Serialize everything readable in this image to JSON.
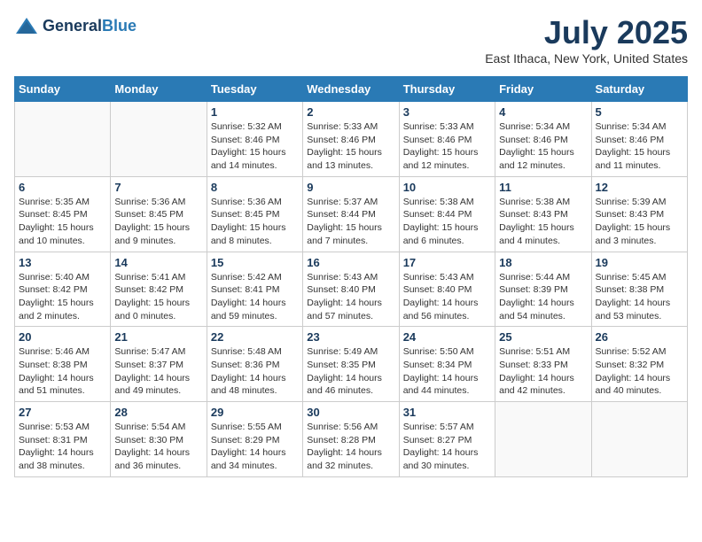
{
  "header": {
    "logo_line1": "General",
    "logo_line2": "Blue",
    "month": "July 2025",
    "location": "East Ithaca, New York, United States"
  },
  "days_of_week": [
    "Sunday",
    "Monday",
    "Tuesday",
    "Wednesday",
    "Thursday",
    "Friday",
    "Saturday"
  ],
  "weeks": [
    [
      {
        "day": "",
        "empty": true
      },
      {
        "day": "",
        "empty": true
      },
      {
        "day": "1",
        "sunrise": "5:32 AM",
        "sunset": "8:46 PM",
        "daylight": "15 hours and 14 minutes."
      },
      {
        "day": "2",
        "sunrise": "5:33 AM",
        "sunset": "8:46 PM",
        "daylight": "15 hours and 13 minutes."
      },
      {
        "day": "3",
        "sunrise": "5:33 AM",
        "sunset": "8:46 PM",
        "daylight": "15 hours and 12 minutes."
      },
      {
        "day": "4",
        "sunrise": "5:34 AM",
        "sunset": "8:46 PM",
        "daylight": "15 hours and 12 minutes."
      },
      {
        "day": "5",
        "sunrise": "5:34 AM",
        "sunset": "8:46 PM",
        "daylight": "15 hours and 11 minutes."
      }
    ],
    [
      {
        "day": "6",
        "sunrise": "5:35 AM",
        "sunset": "8:45 PM",
        "daylight": "15 hours and 10 minutes."
      },
      {
        "day": "7",
        "sunrise": "5:36 AM",
        "sunset": "8:45 PM",
        "daylight": "15 hours and 9 minutes."
      },
      {
        "day": "8",
        "sunrise": "5:36 AM",
        "sunset": "8:45 PM",
        "daylight": "15 hours and 8 minutes."
      },
      {
        "day": "9",
        "sunrise": "5:37 AM",
        "sunset": "8:44 PM",
        "daylight": "15 hours and 7 minutes."
      },
      {
        "day": "10",
        "sunrise": "5:38 AM",
        "sunset": "8:44 PM",
        "daylight": "15 hours and 6 minutes."
      },
      {
        "day": "11",
        "sunrise": "5:38 AM",
        "sunset": "8:43 PM",
        "daylight": "15 hours and 4 minutes."
      },
      {
        "day": "12",
        "sunrise": "5:39 AM",
        "sunset": "8:43 PM",
        "daylight": "15 hours and 3 minutes."
      }
    ],
    [
      {
        "day": "13",
        "sunrise": "5:40 AM",
        "sunset": "8:42 PM",
        "daylight": "15 hours and 2 minutes."
      },
      {
        "day": "14",
        "sunrise": "5:41 AM",
        "sunset": "8:42 PM",
        "daylight": "15 hours and 0 minutes."
      },
      {
        "day": "15",
        "sunrise": "5:42 AM",
        "sunset": "8:41 PM",
        "daylight": "14 hours and 59 minutes."
      },
      {
        "day": "16",
        "sunrise": "5:43 AM",
        "sunset": "8:40 PM",
        "daylight": "14 hours and 57 minutes."
      },
      {
        "day": "17",
        "sunrise": "5:43 AM",
        "sunset": "8:40 PM",
        "daylight": "14 hours and 56 minutes."
      },
      {
        "day": "18",
        "sunrise": "5:44 AM",
        "sunset": "8:39 PM",
        "daylight": "14 hours and 54 minutes."
      },
      {
        "day": "19",
        "sunrise": "5:45 AM",
        "sunset": "8:38 PM",
        "daylight": "14 hours and 53 minutes."
      }
    ],
    [
      {
        "day": "20",
        "sunrise": "5:46 AM",
        "sunset": "8:38 PM",
        "daylight": "14 hours and 51 minutes."
      },
      {
        "day": "21",
        "sunrise": "5:47 AM",
        "sunset": "8:37 PM",
        "daylight": "14 hours and 49 minutes."
      },
      {
        "day": "22",
        "sunrise": "5:48 AM",
        "sunset": "8:36 PM",
        "daylight": "14 hours and 48 minutes."
      },
      {
        "day": "23",
        "sunrise": "5:49 AM",
        "sunset": "8:35 PM",
        "daylight": "14 hours and 46 minutes."
      },
      {
        "day": "24",
        "sunrise": "5:50 AM",
        "sunset": "8:34 PM",
        "daylight": "14 hours and 44 minutes."
      },
      {
        "day": "25",
        "sunrise": "5:51 AM",
        "sunset": "8:33 PM",
        "daylight": "14 hours and 42 minutes."
      },
      {
        "day": "26",
        "sunrise": "5:52 AM",
        "sunset": "8:32 PM",
        "daylight": "14 hours and 40 minutes."
      }
    ],
    [
      {
        "day": "27",
        "sunrise": "5:53 AM",
        "sunset": "8:31 PM",
        "daylight": "14 hours and 38 minutes."
      },
      {
        "day": "28",
        "sunrise": "5:54 AM",
        "sunset": "8:30 PM",
        "daylight": "14 hours and 36 minutes."
      },
      {
        "day": "29",
        "sunrise": "5:55 AM",
        "sunset": "8:29 PM",
        "daylight": "14 hours and 34 minutes."
      },
      {
        "day": "30",
        "sunrise": "5:56 AM",
        "sunset": "8:28 PM",
        "daylight": "14 hours and 32 minutes."
      },
      {
        "day": "31",
        "sunrise": "5:57 AM",
        "sunset": "8:27 PM",
        "daylight": "14 hours and 30 minutes."
      },
      {
        "day": "",
        "empty": true
      },
      {
        "day": "",
        "empty": true
      }
    ]
  ]
}
